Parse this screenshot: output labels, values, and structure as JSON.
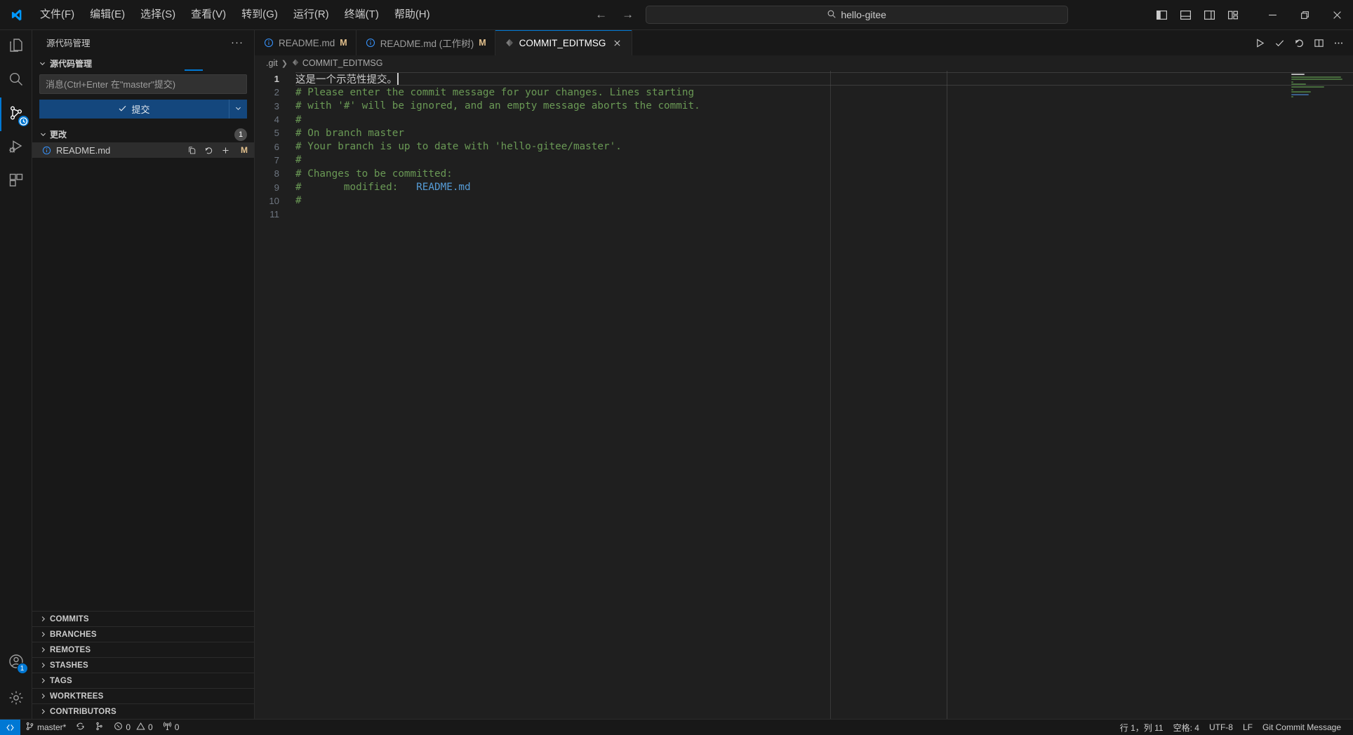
{
  "titlebar": {
    "logo_icon": "vscode-logo",
    "menus": [
      {
        "label": "文件(F)"
      },
      {
        "label": "编辑(E)"
      },
      {
        "label": "选择(S)"
      },
      {
        "label": "查看(V)"
      },
      {
        "label": "转到(G)"
      },
      {
        "label": "运行(R)"
      },
      {
        "label": "终端(T)"
      },
      {
        "label": "帮助(H)"
      }
    ],
    "nav": {
      "back": "←",
      "forward": "→"
    },
    "command_center": {
      "icon": "search-icon",
      "text": "hello-gitee"
    },
    "layout_buttons": [
      {
        "name": "toggle-primary-sidebar",
        "icon": "layout-sidebar-left-icon"
      },
      {
        "name": "toggle-panel",
        "icon": "layout-panel-icon"
      },
      {
        "name": "toggle-secondary-sidebar",
        "icon": "layout-sidebar-right-icon"
      },
      {
        "name": "customize-layout",
        "icon": "layout-customize-icon"
      }
    ],
    "window_controls": [
      {
        "name": "minimize",
        "icon": "minimize-icon"
      },
      {
        "name": "maximize",
        "icon": "restore-icon"
      },
      {
        "name": "close",
        "icon": "close-icon"
      }
    ]
  },
  "activitybar": {
    "items": [
      {
        "name": "explorer",
        "icon": "files-icon",
        "active": false
      },
      {
        "name": "search",
        "icon": "search-icon",
        "active": false
      },
      {
        "name": "source-control",
        "icon": "source-control-icon",
        "active": true,
        "badge": "clock"
      },
      {
        "name": "run-and-debug",
        "icon": "debug-icon",
        "active": false
      },
      {
        "name": "extensions",
        "icon": "extensions-icon",
        "active": false
      }
    ],
    "bottom": [
      {
        "name": "accounts",
        "icon": "account-icon",
        "badge": "1"
      },
      {
        "name": "manage-settings",
        "icon": "gear-icon"
      }
    ]
  },
  "sidebar": {
    "title": "源代码管理",
    "more_actions": "···",
    "scm": {
      "header": "源代码管理",
      "input_placeholder": "消息(Ctrl+Enter 在\"master\"提交)",
      "input_value": "",
      "commit_label": "提交",
      "commit_dropdown_icon": "chevron-down-icon"
    },
    "changes": {
      "header": "更改",
      "count": "1",
      "rows": [
        {
          "name": "README.md",
          "status": "M",
          "actions": [
            {
              "name": "open-file",
              "icon": "open-file-icon"
            },
            {
              "name": "discard-changes",
              "icon": "discard-icon"
            },
            {
              "name": "stage-changes",
              "icon": "plus-icon"
            }
          ]
        }
      ]
    },
    "collapsed_sections": [
      {
        "label": "COMMITS"
      },
      {
        "label": "BRANCHES"
      },
      {
        "label": "REMOTES"
      },
      {
        "label": "STASHES"
      },
      {
        "label": "TAGS"
      },
      {
        "label": "WORKTREES"
      },
      {
        "label": "CONTRIBUTORS"
      }
    ]
  },
  "editor": {
    "tabs": [
      {
        "label": "README.md",
        "icon": "info-icon",
        "modified": "M",
        "active": false,
        "closable": false
      },
      {
        "label": "README.md (工作树)",
        "icon": "info-icon",
        "modified": "M",
        "active": false,
        "closable": false
      },
      {
        "label": "COMMIT_EDITMSG",
        "icon": "diamond-icon",
        "modified": "",
        "active": true,
        "closable": true
      }
    ],
    "actions": [
      {
        "name": "run-or-preview",
        "icon": "play-icon"
      },
      {
        "name": "accept-commit",
        "icon": "check-icon"
      },
      {
        "name": "discard-commit",
        "icon": "undo-icon"
      },
      {
        "name": "split-editor-right",
        "icon": "split-editor-icon"
      },
      {
        "name": "more-actions",
        "icon": "ellipsis-icon"
      }
    ],
    "breadcrumb": [
      {
        "label": ".git",
        "icon": ""
      },
      {
        "label": "COMMIT_EDITMSG",
        "icon": "diamond-icon"
      }
    ],
    "lines": [
      {
        "n": "1",
        "text": "这是一个示范性提交。",
        "kind": "cn",
        "current": true
      },
      {
        "n": "2",
        "text": "# Please enter the commit message for your changes. Lines starting",
        "kind": "comment"
      },
      {
        "n": "3",
        "text": "# with '#' will be ignored, and an empty message aborts the commit.",
        "kind": "comment"
      },
      {
        "n": "4",
        "text": "#",
        "kind": "comment"
      },
      {
        "n": "5",
        "text": "# On branch master",
        "kind": "comment"
      },
      {
        "n": "6",
        "text": "# Your branch is up to date with 'hello-gitee/master'.",
        "kind": "comment"
      },
      {
        "n": "7",
        "text": "#",
        "kind": "comment"
      },
      {
        "n": "8",
        "text": "# Changes to be committed:",
        "kind": "comment"
      },
      {
        "n": "9",
        "text": "#\tmodified:   ",
        "kind": "comment-link",
        "link": "README.md"
      },
      {
        "n": "10",
        "text": "#",
        "kind": "comment"
      },
      {
        "n": "11",
        "text": "",
        "kind": "empty"
      }
    ]
  },
  "statusbar": {
    "left": [
      {
        "name": "remote-indicator",
        "icon": "remote-icon",
        "label": ""
      },
      {
        "name": "branch",
        "icon": "git-branch-icon",
        "label": "master*"
      },
      {
        "name": "sync-changes",
        "icon": "sync-icon",
        "label": ""
      },
      {
        "name": "checkout-branch",
        "icon": "git-branch-alt-icon",
        "label": ""
      },
      {
        "name": "problems",
        "icon": "error-warning-icon",
        "label": "0  0",
        "errors": "0",
        "warnings": "0"
      },
      {
        "name": "ports",
        "icon": "radio-tower-icon",
        "label": "0"
      }
    ],
    "right": [
      {
        "name": "cursor-position",
        "label": "行 1，列 11"
      },
      {
        "name": "indentation",
        "label": "空格: 4"
      },
      {
        "name": "encoding",
        "label": "UTF-8"
      },
      {
        "name": "eol",
        "label": "LF"
      },
      {
        "name": "language-mode",
        "label": "Git Commit Message"
      }
    ]
  },
  "colors": {
    "accent": "#0078d4",
    "commit_button": "#14477d",
    "comment_green": "#6a9955",
    "link_blue": "#569cd6",
    "modified_orange": "#e2c08d",
    "editor_bg": "#1f1f1f",
    "chrome_bg": "#181818"
  }
}
